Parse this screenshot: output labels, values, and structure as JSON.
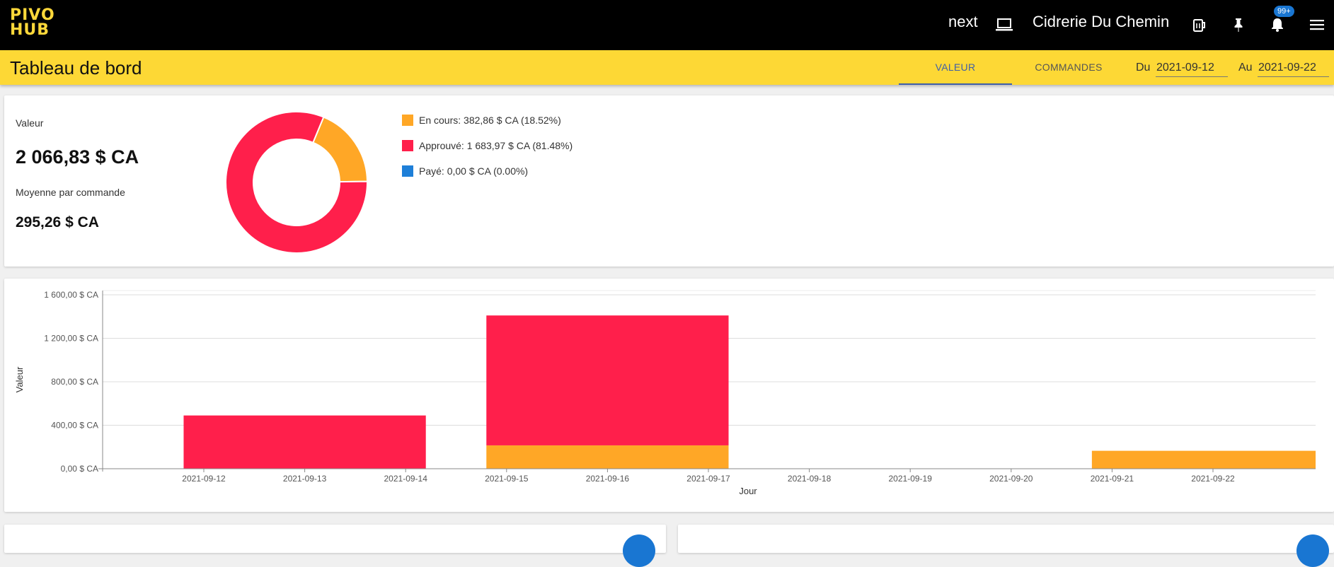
{
  "app": {
    "logo_line1": "PIVO",
    "logo_line2": "HUB",
    "env_label": "next",
    "company": "Cidrerie Du Chemin",
    "notif_badge": "99+",
    "icons": [
      "laptop-icon",
      "beer-mug-icon",
      "pin-icon",
      "bell-icon",
      "menu-icon"
    ]
  },
  "subbar": {
    "title": "Tableau de bord",
    "tabs": [
      {
        "label": "VALEUR",
        "active": true
      },
      {
        "label": "COMMANDES",
        "active": false
      }
    ],
    "from_label": "Du",
    "from_value": "2021-09-12",
    "to_label": "Au",
    "to_value": "2021-09-22"
  },
  "summary": {
    "value_label": "Valeur",
    "value": "2 066,83 $ CA",
    "avg_label": "Moyenne par commande",
    "avg_value": "295,26 $ CA"
  },
  "colors": {
    "en_cours": "#ffa726",
    "approuve": "#ff1f4b",
    "paye": "#1e7fd8",
    "brand_yellow": "#fdd835"
  },
  "chart_data": [
    {
      "type": "pie",
      "donut": true,
      "slices": [
        {
          "label": "En cours: 382,86 $ CA (18.52%)",
          "value": 382.86,
          "percent": 18.52,
          "color": "#ffa726"
        },
        {
          "label": "Approuvé: 1 683,97 $ CA (81.48%)",
          "value": 1683.97,
          "percent": 81.48,
          "color": "#ff1f4b"
        },
        {
          "label": "Payé: 0,00 $ CA (0.00%)",
          "value": 0,
          "percent": 0,
          "color": "#1e7fd8"
        }
      ],
      "legend_position": "right"
    },
    {
      "type": "bar",
      "stacked": true,
      "xlabel": "Jour",
      "ylabel": "Valeur",
      "x_ticks": [
        "2021-09-12",
        "2021-09-13",
        "2021-09-14",
        "2021-09-15",
        "2021-09-16",
        "2021-09-17",
        "2021-09-18",
        "2021-09-19",
        "2021-09-20",
        "2021-09-21",
        "2021-09-22"
      ],
      "y_ticks": [
        "0,00 $ CA",
        "400,00 $ CA",
        "800,00 $ CA",
        "1 200,00 $ CA",
        "1 600,00 $ CA"
      ],
      "ylim": [
        0,
        1600
      ],
      "grid": true,
      "bars": [
        {
          "x_start": "2021-09-12",
          "x_end": "2021-09-14",
          "series": {
            "En cours": 0,
            "Approuvé": 490
          }
        },
        {
          "x_start": "2021-09-15",
          "x_end": "2021-09-17",
          "series": {
            "En cours": 215,
            "Approuvé": 1195
          }
        },
        {
          "x_start": "2021-09-21",
          "x_end": "2021-09-22",
          "series": {
            "En cours": 165,
            "Approuvé": 0
          }
        }
      ]
    }
  ]
}
